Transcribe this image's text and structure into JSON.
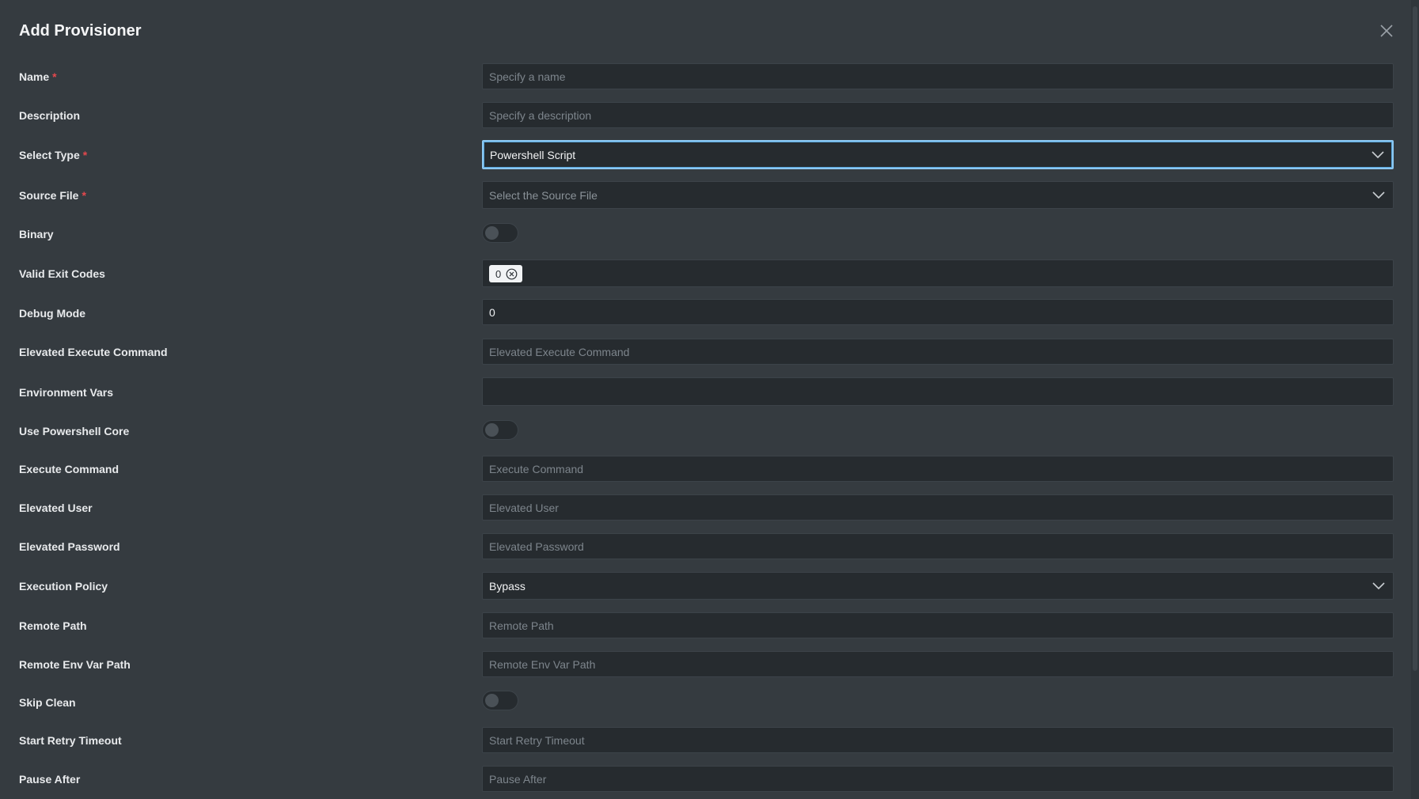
{
  "modal": {
    "title": "Add Provisioner",
    "close_icon": "close-icon"
  },
  "fields": {
    "name": {
      "label": "Name",
      "placeholder": "Specify a name",
      "required": "*"
    },
    "description": {
      "label": "Description",
      "placeholder": "Specify a description"
    },
    "select_type": {
      "label": "Select Type",
      "value": "Powershell Script",
      "required": "*"
    },
    "source_file": {
      "label": "Source File",
      "placeholder": "Select the Source File",
      "required": "*"
    },
    "binary": {
      "label": "Binary"
    },
    "valid_exit_codes": {
      "label": "Valid Exit Codes",
      "tags": [
        "0"
      ]
    },
    "debug_mode": {
      "label": "Debug Mode",
      "value": "0"
    },
    "elevated_execute_command": {
      "label": "Elevated Execute Command",
      "placeholder": "Elevated Execute Command"
    },
    "environment_vars": {
      "label": "Environment Vars"
    },
    "use_powershell_core": {
      "label": "Use Powershell Core"
    },
    "execute_command": {
      "label": "Execute Command",
      "placeholder": "Execute Command"
    },
    "elevated_user": {
      "label": "Elevated User",
      "placeholder": "Elevated User"
    },
    "elevated_password": {
      "label": "Elevated Password",
      "placeholder": "Elevated Password"
    },
    "execution_policy": {
      "label": "Execution Policy",
      "value": "Bypass"
    },
    "remote_path": {
      "label": "Remote Path",
      "placeholder": "Remote Path"
    },
    "remote_env_var_path": {
      "label": "Remote Env Var Path",
      "placeholder": "Remote Env Var Path"
    },
    "skip_clean": {
      "label": "Skip Clean"
    },
    "start_retry_timeout": {
      "label": "Start Retry Timeout",
      "placeholder": "Start Retry Timeout"
    },
    "pause_after": {
      "label": "Pause After",
      "placeholder": "Pause After"
    }
  },
  "colors": {
    "background": "#353b40",
    "field_bg": "#262b2f",
    "focus_border": "#8cc8f2",
    "required": "#e5484d"
  }
}
